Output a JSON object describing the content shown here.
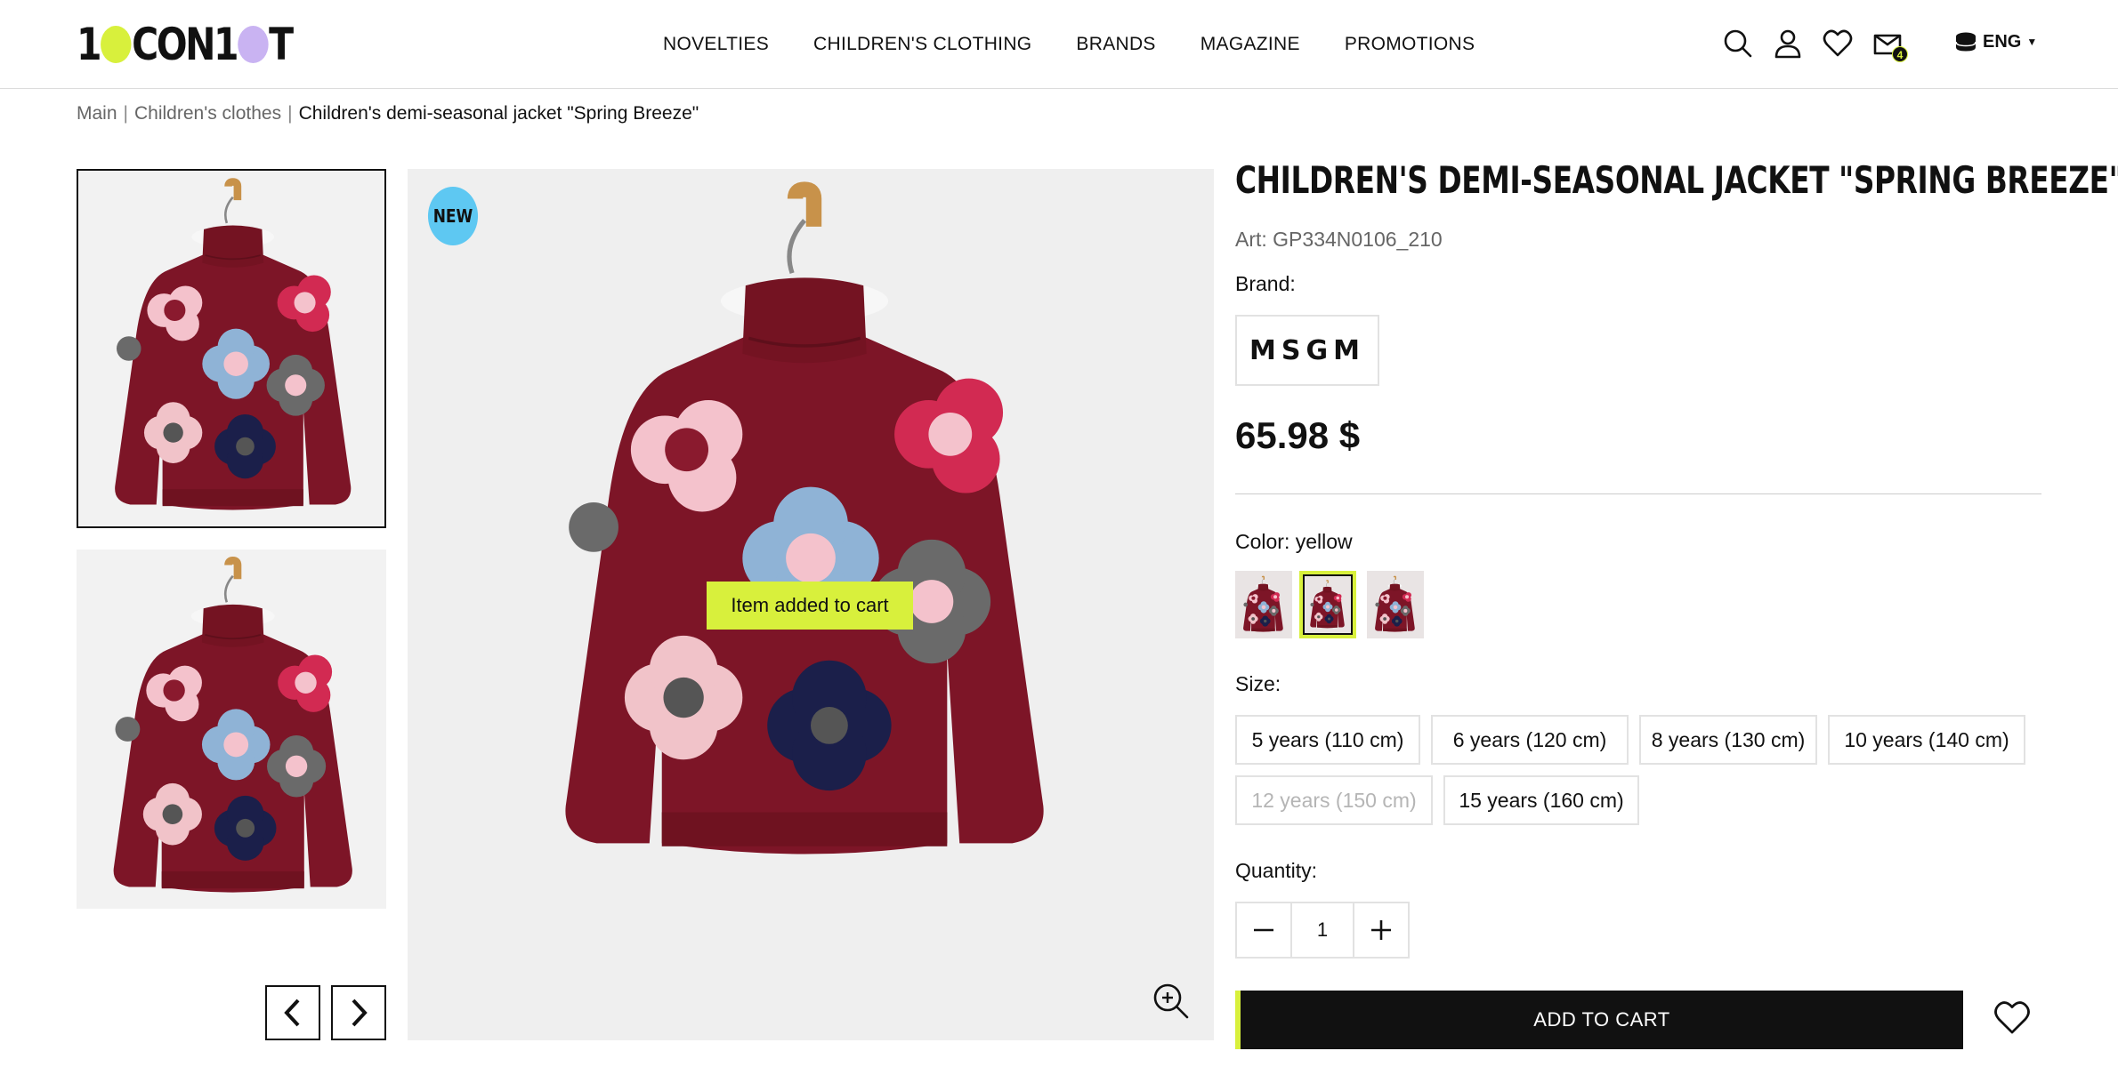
{
  "header": {
    "logo_text": "10CON10T",
    "nav": [
      "NOVELTIES",
      "CHILDREN'S CLOTHING",
      "BRANDS",
      "MAGAZINE",
      "PROMOTIONS"
    ],
    "cart_count": "4",
    "language": "ENG",
    "icons": [
      "search-icon",
      "user-icon",
      "heart-icon",
      "cart-icon",
      "globe-icon"
    ],
    "colors": {
      "accent_lime": "#d8f03c",
      "accent_lilac": "#c9b3f2",
      "new_badge": "#5ec8f2"
    }
  },
  "breadcrumb": {
    "items": [
      "Main",
      "Children's clothes",
      "Children's demi-seasonal jacket \"Spring Breeze\""
    ]
  },
  "gallery": {
    "new_badge": "NEW",
    "toast": "Item added to cart"
  },
  "product": {
    "title": "CHILDREN'S DEMI-SEASONAL JACKET \"SPRING BREEZE\"",
    "art": "Art: GP334N0106_210",
    "brand_label": "Brand:",
    "brand_name": "MSGM",
    "price": "65.98 $",
    "color_label": "Color: yellow",
    "size_label": "Size:",
    "sizes": [
      {
        "label": "5 years (110 cm)",
        "available": true
      },
      {
        "label": "6 years (120 cm)",
        "available": true
      },
      {
        "label": "8 years (130 cm)",
        "available": true
      },
      {
        "label": "10 years (140 cm)",
        "available": true
      },
      {
        "label": "12 years (150 cm)",
        "available": false
      },
      {
        "label": "15 years (160 cm)",
        "available": true
      }
    ],
    "quantity_label": "Quantity:",
    "quantity": "1",
    "add_to_cart": "ADD TO CART"
  }
}
